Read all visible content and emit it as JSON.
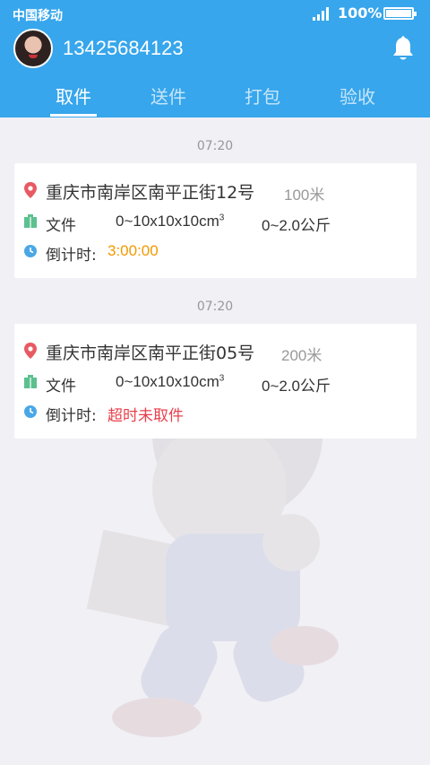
{
  "status_bar": {
    "carrier": "中国移动",
    "battery_percent": "100%"
  },
  "header": {
    "phone": "13425684123",
    "tabs": [
      {
        "label": "取件",
        "active": true
      },
      {
        "label": "送件",
        "active": false
      },
      {
        "label": "打包",
        "active": false
      },
      {
        "label": "验收",
        "active": false
      }
    ]
  },
  "orders": [
    {
      "time": "07:20",
      "address": "重庆市南岸区南平正街12号",
      "distance": "100米",
      "type_label": "文件",
      "size": "0~10x10x10cm",
      "size_sup": "3",
      "weight": "0~2.0公斤",
      "countdown_label": "倒计时:",
      "countdown_value": "3:00:00",
      "countdown_color": "#f39800"
    },
    {
      "time": "07:20",
      "address": "重庆市南岸区南平正街05号",
      "distance": "200米",
      "type_label": "文件",
      "size": "0~10x10x10cm",
      "size_sup": "3",
      "weight": "0~2.0公斤",
      "countdown_label": "倒计时:",
      "countdown_value": "超时未取件",
      "countdown_color": "#e8414b"
    }
  ],
  "colors": {
    "header_bg": "#37a6ec",
    "page_bg": "#f0f0f5",
    "location_icon": "#e85a63",
    "package_icon": "#5cc08f",
    "clock_icon": "#4aa7e6"
  }
}
